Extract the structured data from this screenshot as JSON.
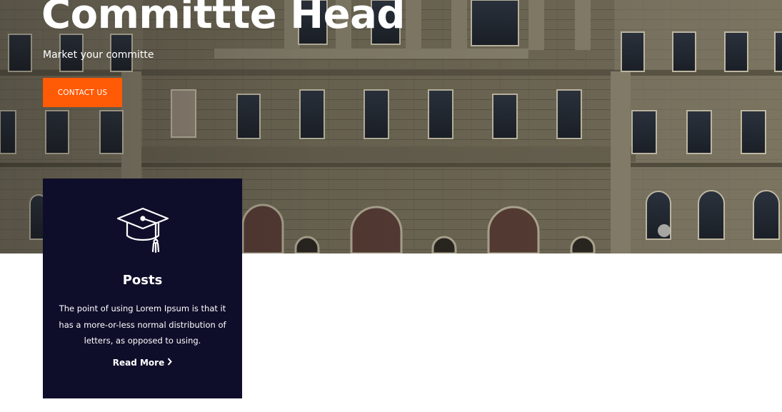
{
  "hero": {
    "title": "Committte Head",
    "subtitle": "Market your committe",
    "contact_label": "CONTACT US"
  },
  "card": {
    "icon": "graduation-cap-icon",
    "title": "Posts",
    "text": "The point of using Lorem Ipsum is that it has a more-or-less normal distribution of letters, as opposed to using.",
    "read_more_label": "Read More",
    "read_more_icon": "chevron-right-icon"
  },
  "colors": {
    "accent": "#ff5a05",
    "card_bg": "#0e0e2b",
    "building": "#7a735e"
  }
}
